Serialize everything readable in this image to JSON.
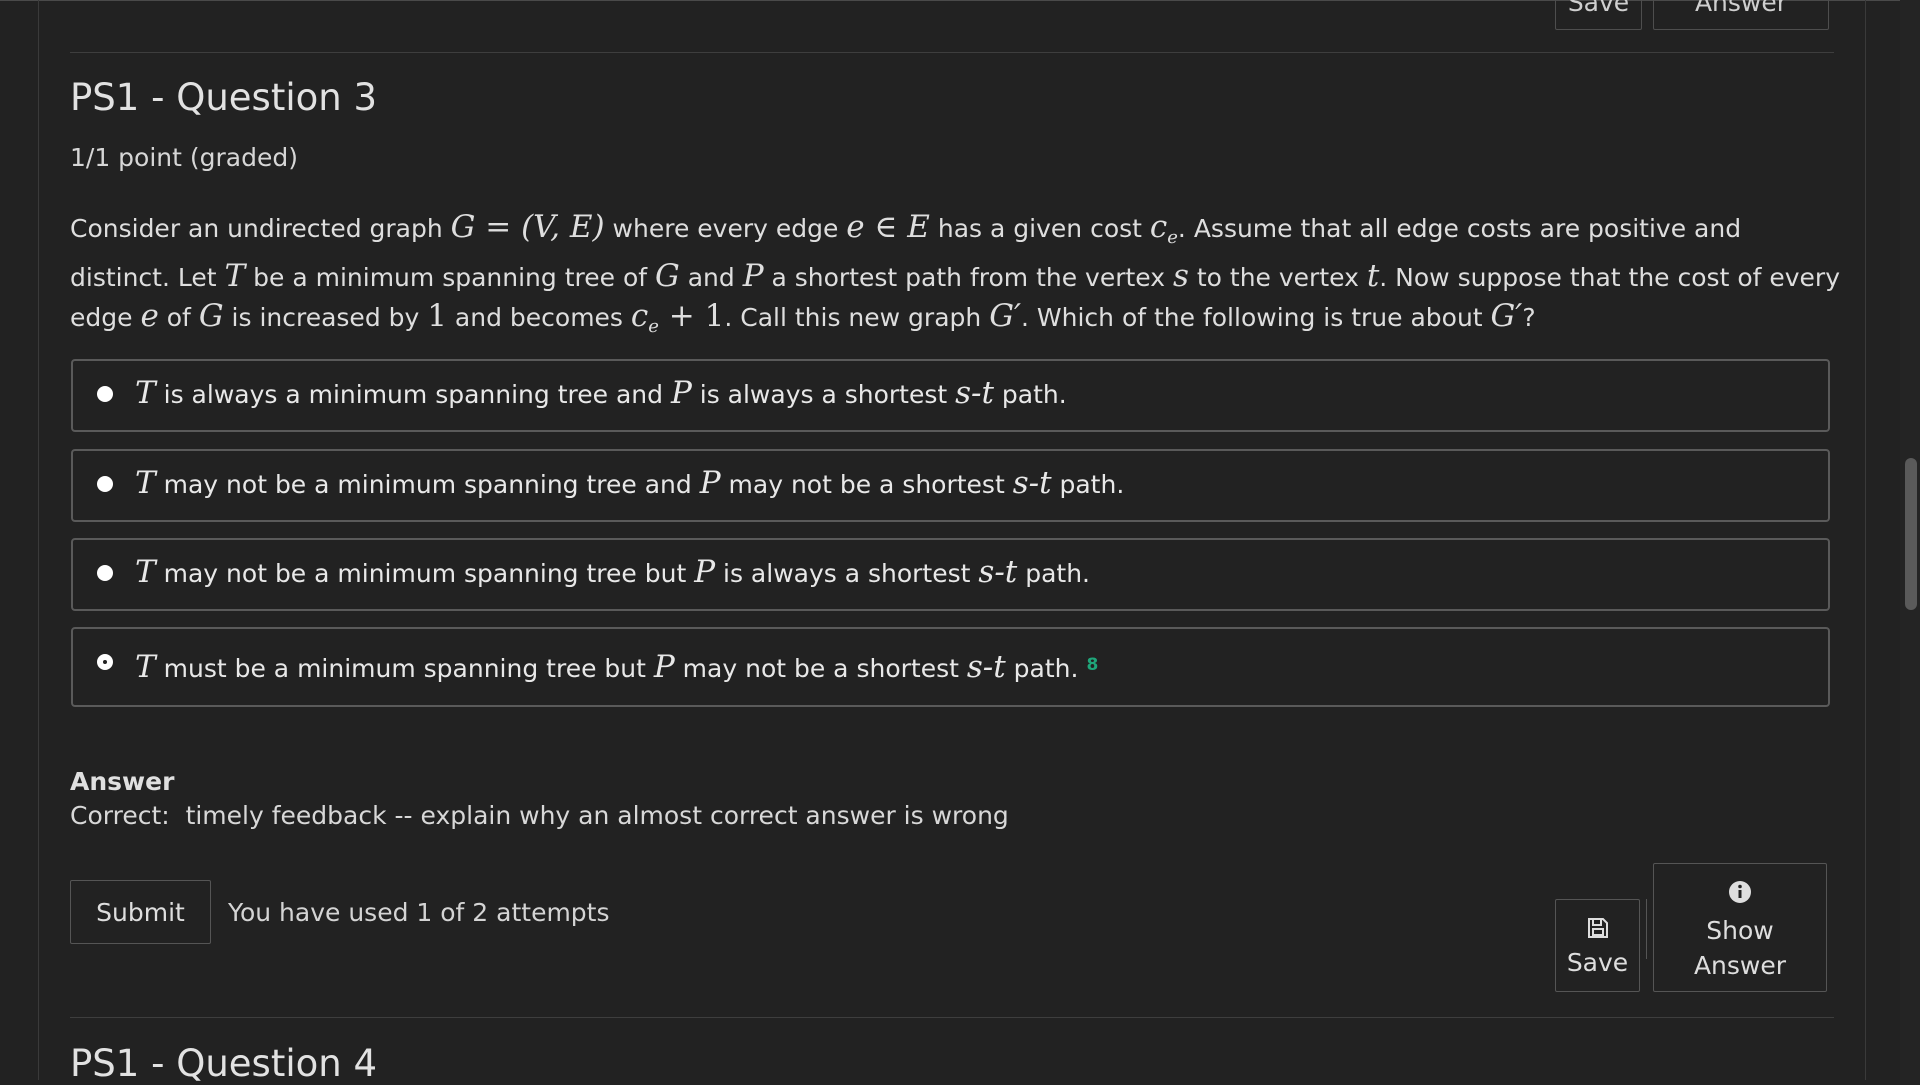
{
  "prev_controls": {
    "save_label": "Save",
    "answer_label": "Answer"
  },
  "question": {
    "title": "PS1 - Question 3",
    "points": "1/1 point (graded)",
    "text": {
      "s1": "Consider an undirected graph ",
      "m_graph": "G = (V, E)",
      "s2": " where every edge ",
      "m_edge": "e ∈ E",
      "s3": " has a given cost ",
      "m_c": "c",
      "m_c_sub": "e",
      "s4": ". Assume that all edge costs are positive and distinct. Let ",
      "m_T": "T",
      "s5": " be a minimum spanning tree of ",
      "m_G": "G",
      "s6": " and ",
      "m_P": "P",
      "s7": " a shortest path from the vertex ",
      "m_s": "s",
      "s8": " to the vertex ",
      "m_t": "t",
      "s9": ". Now suppose that the cost of every edge ",
      "m_e": "e",
      "s10": " of ",
      "m_G2": "G",
      "s11": " is increased by ",
      "m_one": "1",
      "s12": " and becomes ",
      "m_c2": "c",
      "m_c2_sub": "e",
      "m_plus": " + 1",
      "s13": ". Call this new graph ",
      "m_Gp": "G′",
      "s14": ". Which of the following is true about ",
      "m_Gp2": "G′",
      "s15": "?"
    }
  },
  "options": [
    {
      "T": "T",
      "a": " is always a minimum spanning tree and ",
      "P": "P",
      "b": " is always a shortest ",
      "st": "s-t",
      "c": " path.",
      "selected": false
    },
    {
      "T": "T",
      "a": " may not be a minimum spanning tree and ",
      "P": "P",
      "b": " may not be a shortest ",
      "st": "s-t",
      "c": " path.",
      "selected": false
    },
    {
      "T": "T",
      "a": " may not be a minimum spanning tree but ",
      "P": "P",
      "b": " is always a shortest ",
      "st": "s-t",
      "c": " path.",
      "selected": false
    },
    {
      "T": "T",
      "a": " must be a minimum spanning tree but ",
      "P": "P",
      "b": " may not be a shortest ",
      "st": "s-t",
      "c": " path.",
      "selected": true,
      "mark": "8"
    }
  ],
  "answer": {
    "heading": "Answer",
    "text": "Correct:  timely feedback -- explain why an almost correct answer is wrong"
  },
  "actions": {
    "submit_label": "Submit",
    "attempts_text": "You have used 1 of 2 attempts",
    "save_label": "Save",
    "show_answer_line1": "Show",
    "show_answer_line2": "Answer"
  },
  "next_question": {
    "title": "PS1 - Question 4"
  },
  "colors": {
    "background": "#222222",
    "correct_mark": "#1fa67a",
    "border": "#5a5a5a"
  }
}
